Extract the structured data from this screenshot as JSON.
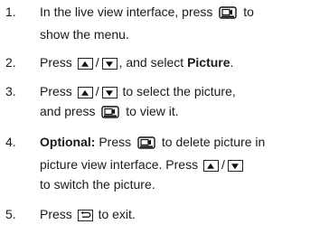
{
  "steps": [
    {
      "number": "1.",
      "line1_a": "In the live view interface, press",
      "line1_b": "to",
      "line2": "show the menu."
    },
    {
      "number": "2.",
      "a": "Press",
      "b": ", and select",
      "bold": "Picture",
      "c": "."
    },
    {
      "number": "3.",
      "line1_a": "Press",
      "line1_b": "to select the picture,",
      "line2_a": "and press",
      "line2_b": "to view it."
    },
    {
      "number": "4.",
      "bold": "Optional:",
      "line1_a": "Press",
      "line1_b": "to delete picture in",
      "line2": "picture view interface. Press",
      "line3": "to switch the picture."
    },
    {
      "number": "5.",
      "a": "Press",
      "b": "to exit."
    }
  ],
  "slash": "/",
  "icons": {
    "menu": "menu-camera-icon",
    "up": "up-arrow-button-icon",
    "down": "down-arrow-button-icon",
    "back": "back-button-icon"
  }
}
